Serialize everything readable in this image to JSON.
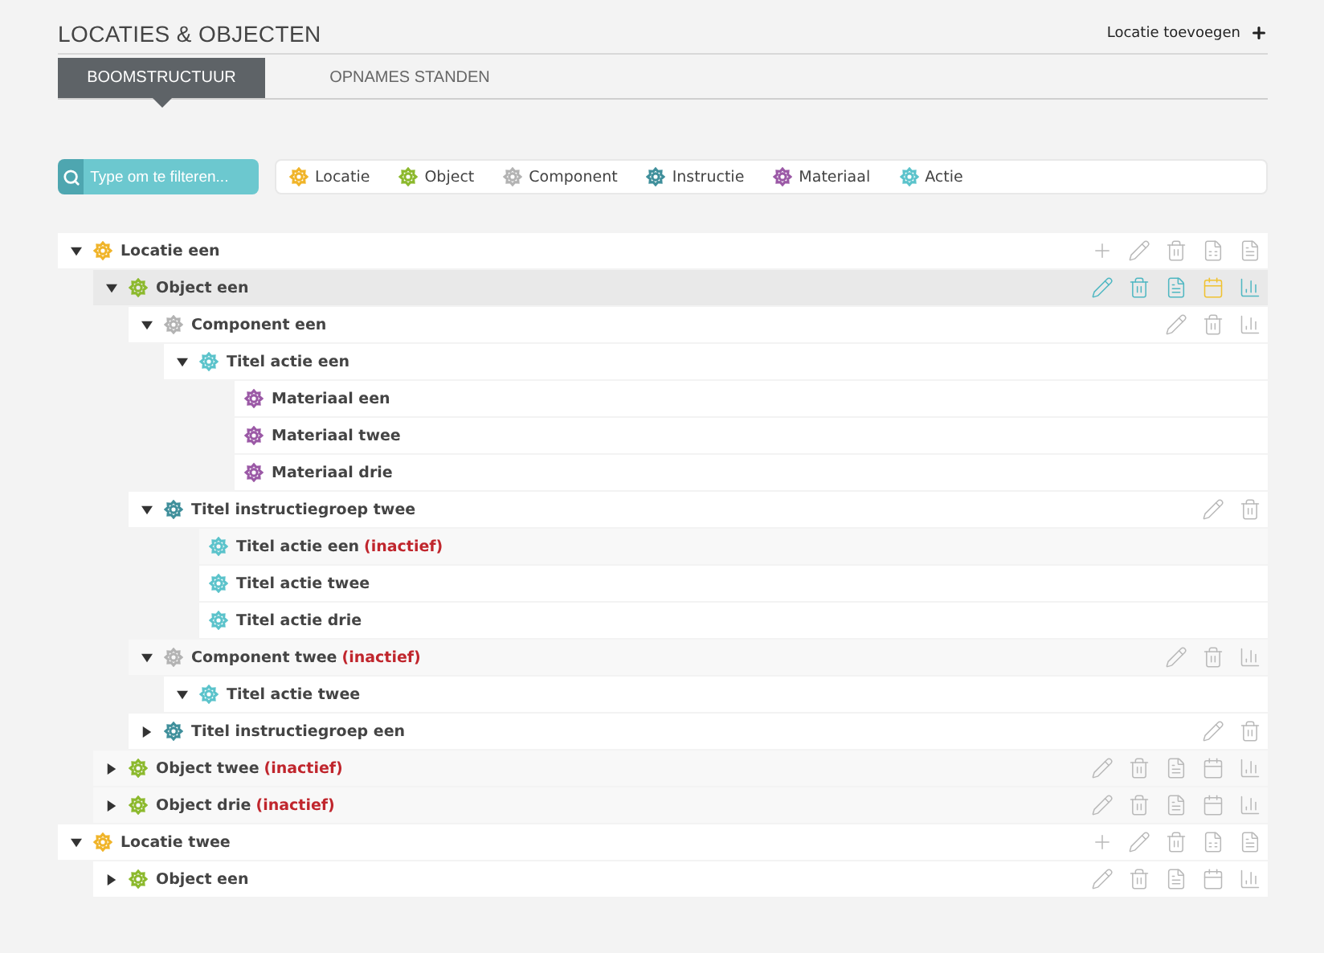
{
  "header": {
    "title": "LOCATIES & OBJECTEN",
    "add_label": "Locatie toevoegen"
  },
  "tabs": [
    {
      "label": "BOOMSTRUCTUUR",
      "selected": true
    },
    {
      "label": "OPNAMES STANDEN",
      "selected": false
    }
  ],
  "filter": {
    "placeholder": "Type om te filteren..."
  },
  "legend": [
    {
      "kind": "locatie",
      "label": "Locatie"
    },
    {
      "kind": "object",
      "label": "Object"
    },
    {
      "kind": "component",
      "label": "Component"
    },
    {
      "kind": "instructie",
      "label": "Instructie"
    },
    {
      "kind": "materiaal",
      "label": "Materiaal"
    },
    {
      "kind": "actie",
      "label": "Actie"
    }
  ],
  "tree": [
    {
      "kind": "locatie",
      "label": "Locatie een",
      "expanded": true,
      "hovered": false,
      "actions": [
        {
          "kind": "add",
          "highlighted": false
        },
        {
          "kind": "edit",
          "highlighted": false
        },
        {
          "kind": "delete",
          "highlighted": false
        },
        {
          "kind": "excel",
          "highlighted": false
        },
        {
          "kind": "pdf",
          "highlighted": false
        }
      ],
      "children": [
        {
          "kind": "object",
          "label": "Object een",
          "expanded": true,
          "hovered": true,
          "actions": [
            {
              "kind": "edit",
              "highlighted": false
            },
            {
              "kind": "delete",
              "highlighted": false
            },
            {
              "kind": "pdf",
              "highlighted": false
            },
            {
              "kind": "calendar",
              "highlighted": true
            },
            {
              "kind": "chart",
              "highlighted": false
            }
          ],
          "children": [
            {
              "kind": "component",
              "label": "Component een",
              "expanded": true,
              "hovered": false,
              "actions": [
                {
                  "kind": "edit",
                  "highlighted": false
                },
                {
                  "kind": "delete",
                  "highlighted": false
                },
                {
                  "kind": "chart",
                  "highlighted": false
                }
              ],
              "children": [
                {
                  "kind": "actie",
                  "label": "Titel actie een",
                  "expanded": true,
                  "hovered": false,
                  "children": [
                    {
                      "kind": "materiaal",
                      "label": "Materiaal een",
                      "hovered": false
                    },
                    {
                      "kind": "materiaal",
                      "label": "Materiaal twee",
                      "hovered": false
                    },
                    {
                      "kind": "materiaal",
                      "label": "Materiaal drie",
                      "hovered": false
                    }
                  ]
                }
              ]
            },
            {
              "kind": "instructie",
              "label": "Titel instructiegroep twee",
              "expanded": true,
              "hovered": false,
              "actions": [
                {
                  "kind": "edit",
                  "highlighted": false
                },
                {
                  "kind": "delete",
                  "highlighted": false
                }
              ],
              "children": [
                {
                  "kind": "actie",
                  "label": "Titel actie een",
                  "status": "(inactief)",
                  "hovered": false
                },
                {
                  "kind": "actie",
                  "label": "Titel actie twee",
                  "hovered": false
                },
                {
                  "kind": "actie",
                  "label": "Titel actie drie",
                  "hovered": false
                }
              ]
            },
            {
              "kind": "component",
              "label": "Component twee",
              "status": "(inactief)",
              "expanded": true,
              "hovered": false,
              "actions": [
                {
                  "kind": "edit",
                  "highlighted": false
                },
                {
                  "kind": "delete",
                  "highlighted": false
                },
                {
                  "kind": "chart",
                  "highlighted": false
                }
              ],
              "children": [
                {
                  "kind": "actie",
                  "label": "Titel actie twee",
                  "expanded": true,
                  "hovered": false
                }
              ]
            },
            {
              "kind": "instructie",
              "label": "Titel instructiegroep een",
              "expanded": false,
              "hovered": false,
              "actions": [
                {
                  "kind": "edit",
                  "highlighted": false
                },
                {
                  "kind": "delete",
                  "highlighted": false
                }
              ]
            }
          ]
        },
        {
          "kind": "object",
          "label": "Object twee",
          "status": "(inactief)",
          "expanded": false,
          "hovered": false,
          "actions": [
            {
              "kind": "edit",
              "highlighted": false
            },
            {
              "kind": "delete",
              "highlighted": false
            },
            {
              "kind": "pdf",
              "highlighted": false
            },
            {
              "kind": "calendar",
              "highlighted": false
            },
            {
              "kind": "chart",
              "highlighted": false
            }
          ]
        },
        {
          "kind": "object",
          "label": "Object drie",
          "status": "(inactief)",
          "expanded": false,
          "hovered": false,
          "actions": [
            {
              "kind": "edit",
              "highlighted": false
            },
            {
              "kind": "delete",
              "highlighted": false
            },
            {
              "kind": "pdf",
              "highlighted": false
            },
            {
              "kind": "calendar",
              "highlighted": false
            },
            {
              "kind": "chart",
              "highlighted": false
            }
          ]
        }
      ]
    },
    {
      "kind": "locatie",
      "label": "Locatie twee",
      "expanded": true,
      "hovered": false,
      "actions": [
        {
          "kind": "add",
          "highlighted": false
        },
        {
          "kind": "edit",
          "highlighted": false
        },
        {
          "kind": "delete",
          "highlighted": false
        },
        {
          "kind": "excel",
          "highlighted": false
        },
        {
          "kind": "pdf",
          "highlighted": false
        }
      ],
      "children": [
        {
          "kind": "object",
          "label": "Object een",
          "expanded": false,
          "hovered": false,
          "actions": [
            {
              "kind": "edit",
              "highlighted": false
            },
            {
              "kind": "delete",
              "highlighted": false
            },
            {
              "kind": "pdf",
              "highlighted": false
            },
            {
              "kind": "calendar",
              "highlighted": false
            },
            {
              "kind": "chart",
              "highlighted": false
            }
          ]
        }
      ]
    }
  ]
}
